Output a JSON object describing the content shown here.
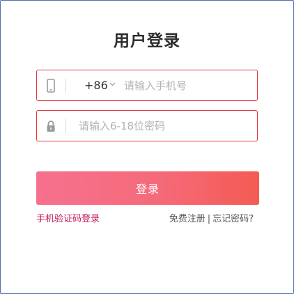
{
  "title": "用户登录",
  "phone_field": {
    "icon": "phone-icon",
    "country_code": "+86",
    "placeholder": "请输入手机号",
    "value": ""
  },
  "password_field": {
    "icon": "lock-icon",
    "placeholder": "请输入6-18位密码",
    "value": ""
  },
  "login_button": "登录",
  "links": {
    "sms_login": "手机验证码登录",
    "register": "免费注册",
    "separator": "|",
    "forgot_password": "忘记密码?"
  },
  "colors": {
    "accent": "#e0393e",
    "button_start": "#f6718f",
    "button_end": "#f45b53",
    "link": "#c2185b"
  }
}
